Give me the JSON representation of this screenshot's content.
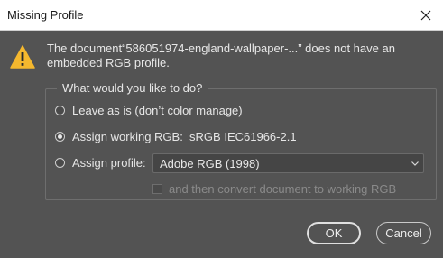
{
  "window": {
    "title": "Missing Profile"
  },
  "message": {
    "line1": "The document“586051974-england-wallpaper-...” does not have an",
    "line2": "embedded RGB profile."
  },
  "group": {
    "legend": "What would you like to do?",
    "options": [
      {
        "label": "Leave as is (don’t color manage)",
        "checked": false
      },
      {
        "label": "Assign working RGB:  sRGB IEC61966-2.1",
        "checked": true
      },
      {
        "label": "Assign profile:",
        "checked": false
      }
    ],
    "profile_select": {
      "value": "Adobe RGB (1998)"
    },
    "convert_checkbox": {
      "label": "and then convert document to working RGB",
      "checked": false,
      "enabled": false
    }
  },
  "buttons": {
    "ok": "OK",
    "cancel": "Cancel"
  },
  "colors": {
    "background": "#535353",
    "titlebar": "#ffffff",
    "warning": "#f5b82e"
  }
}
